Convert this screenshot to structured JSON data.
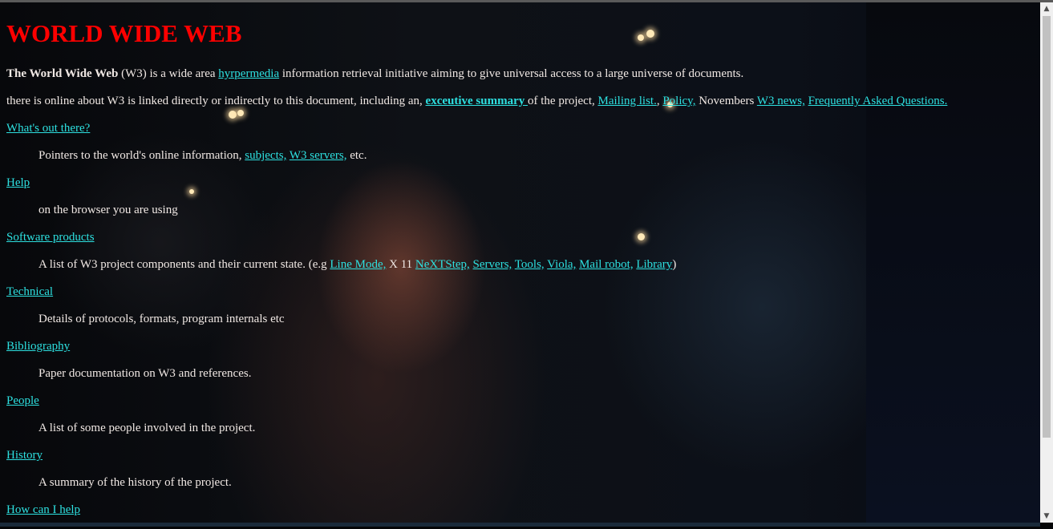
{
  "page": {
    "heading": "WORLD WIDE WEB",
    "intro": {
      "bold": "The World Wide Web",
      "text1": " (W3) is a wide area ",
      "link": "hyrpermedia",
      "text2": " information retrieval initiative aiming to give universal access to a large universe of documents."
    },
    "summary": {
      "text1": "there is online about W3 is linked directly or indirectly to this document, including an, ",
      "link1": "exceutive summary ",
      "text2": "of the project, ",
      "link2": "Mailing list.",
      "text3": ", ",
      "link3": "Policy,",
      "text4": " Novembers ",
      "link4": "W3 news,",
      "text5": " ",
      "link5": "Frequently Asked Questions."
    },
    "sections": [
      {
        "title": "What's out there?",
        "desc_text1": "Pointers to the world's online information, ",
        "desc_link1": "subjects,",
        "desc_text2": " ",
        "desc_link2": "W3 servers,",
        "desc_text3": " etc."
      },
      {
        "title": "Help",
        "desc": "on the browser you are using"
      },
      {
        "title": "Software products",
        "desc_text1": "A list of W3 project components and their current state. (e.g ",
        "links": [
          "Line Mode,",
          "NeXTStep,",
          "Servers,",
          "Tools,",
          "Viola,",
          "Mail robot,",
          "Library"
        ],
        "x11_text": " X 11 ",
        "desc_text_end": ")"
      },
      {
        "title": "Technical",
        "desc": "Details of protocols, formats, program internals etc"
      },
      {
        "title": "Bibliography",
        "desc": "Paper documentation on W3 and references."
      },
      {
        "title": "People",
        "desc": "A list of some people involved in the project."
      },
      {
        "title": "History",
        "desc": "A summary of the history of the project."
      },
      {
        "title": "How can I help"
      }
    ]
  },
  "colors": {
    "heading": "#ff0000",
    "link": "#2de0e0",
    "text": "#f0e8e4"
  },
  "icons": {
    "scroll_up": "chevron-up-icon",
    "scroll_down": "chevron-down-icon"
  }
}
